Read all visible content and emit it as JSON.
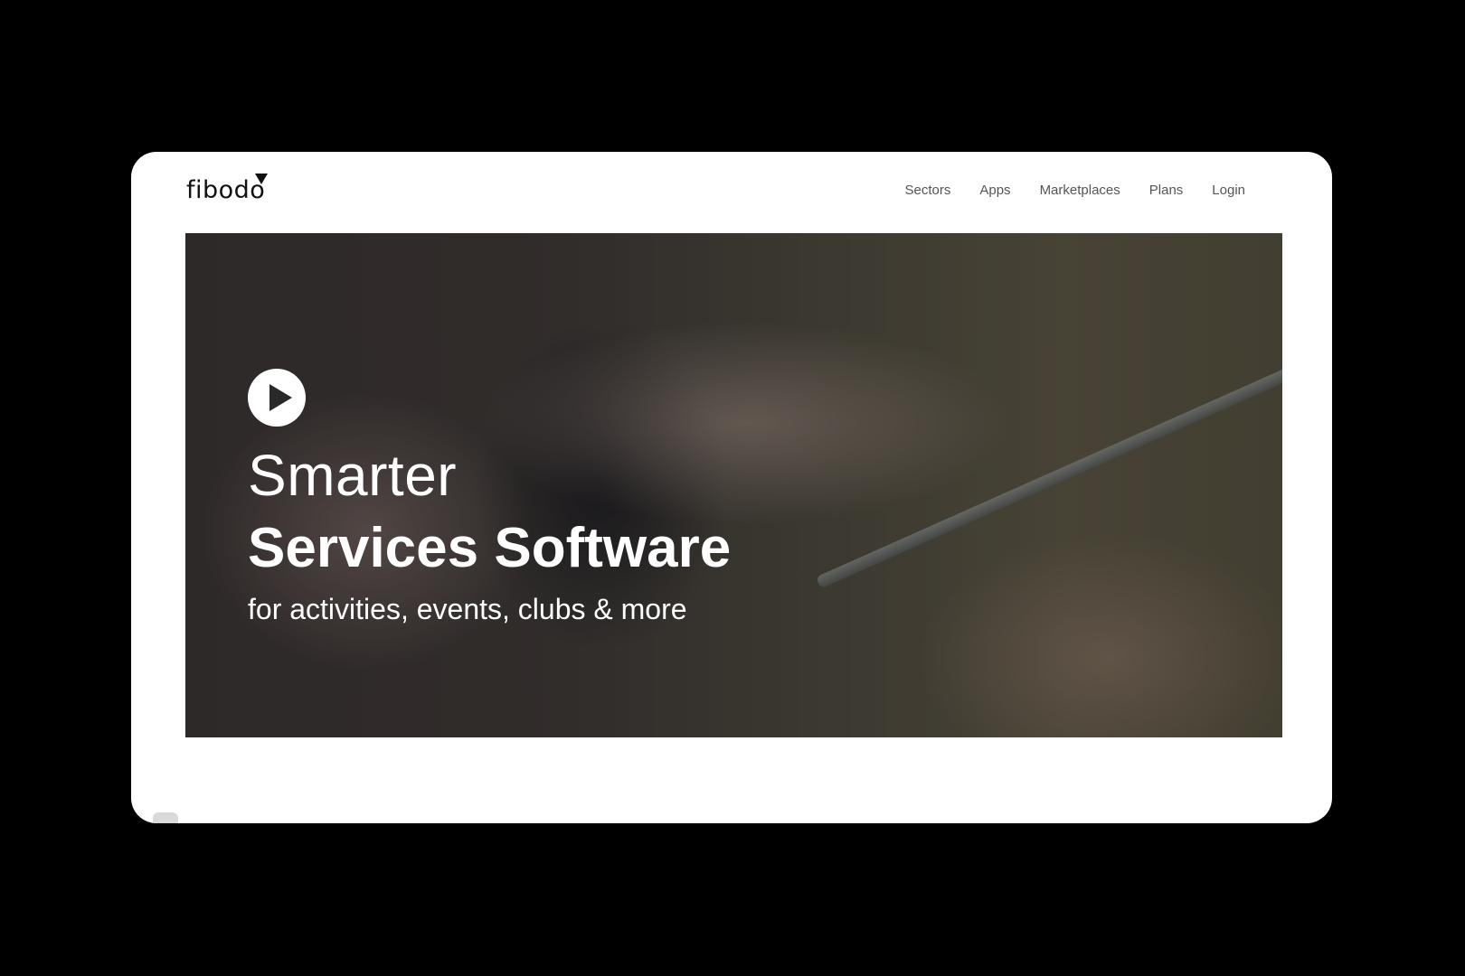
{
  "brand": {
    "logo_text": "fibodo"
  },
  "nav": {
    "items": [
      {
        "label": "Sectors"
      },
      {
        "label": "Apps"
      },
      {
        "label": "Marketplaces"
      },
      {
        "label": "Plans"
      },
      {
        "label": "Login"
      }
    ]
  },
  "hero": {
    "headline_light": "Smarter",
    "headline_bold": "Services Software",
    "subline": "for activities, events, clubs & more",
    "play_icon": "play-icon"
  },
  "colors": {
    "page_background": "#000000",
    "window_background": "#ffffff",
    "nav_text": "#555555",
    "hero_text": "#ffffff"
  }
}
